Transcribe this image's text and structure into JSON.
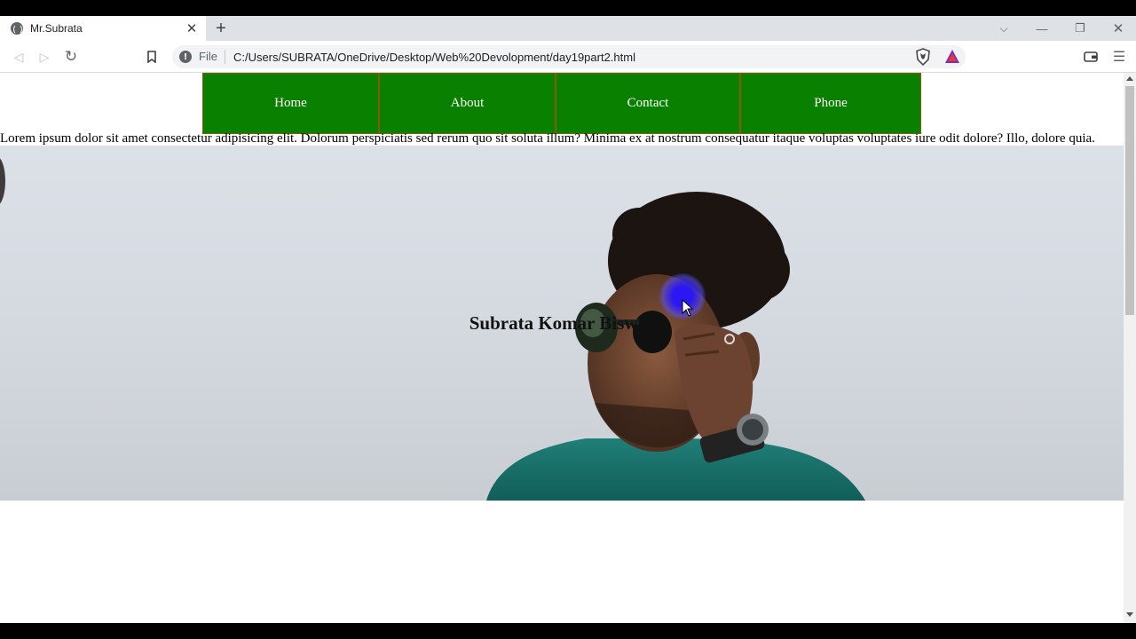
{
  "browser": {
    "tab_title": "Mr.Subrata",
    "tab_close": "✕",
    "new_tab": "+",
    "file_label": "File",
    "url": "C:/Users/SUBRATA/OneDrive/Desktop/Web%20Devolopment/day19part2.html"
  },
  "page": {
    "nav": [
      {
        "label": "Home"
      },
      {
        "label": "About"
      },
      {
        "label": "Contact"
      },
      {
        "label": "Phone"
      }
    ],
    "paragraph": "Lorem ipsum dolor sit amet consectetur adipisicing elit. Dolorum perspiciatis sed rerum quo sit soluta illum? Minima ex at nostrum consequatur itaque voluptas voluptates iure odit dolore? Illo, dolore quia.",
    "hero_name": "Subrata Komar Biswas"
  },
  "colors": {
    "nav_bg": "#0a8000",
    "nav_border": "#8a5a00",
    "cursor_highlight": "#2814ff"
  }
}
